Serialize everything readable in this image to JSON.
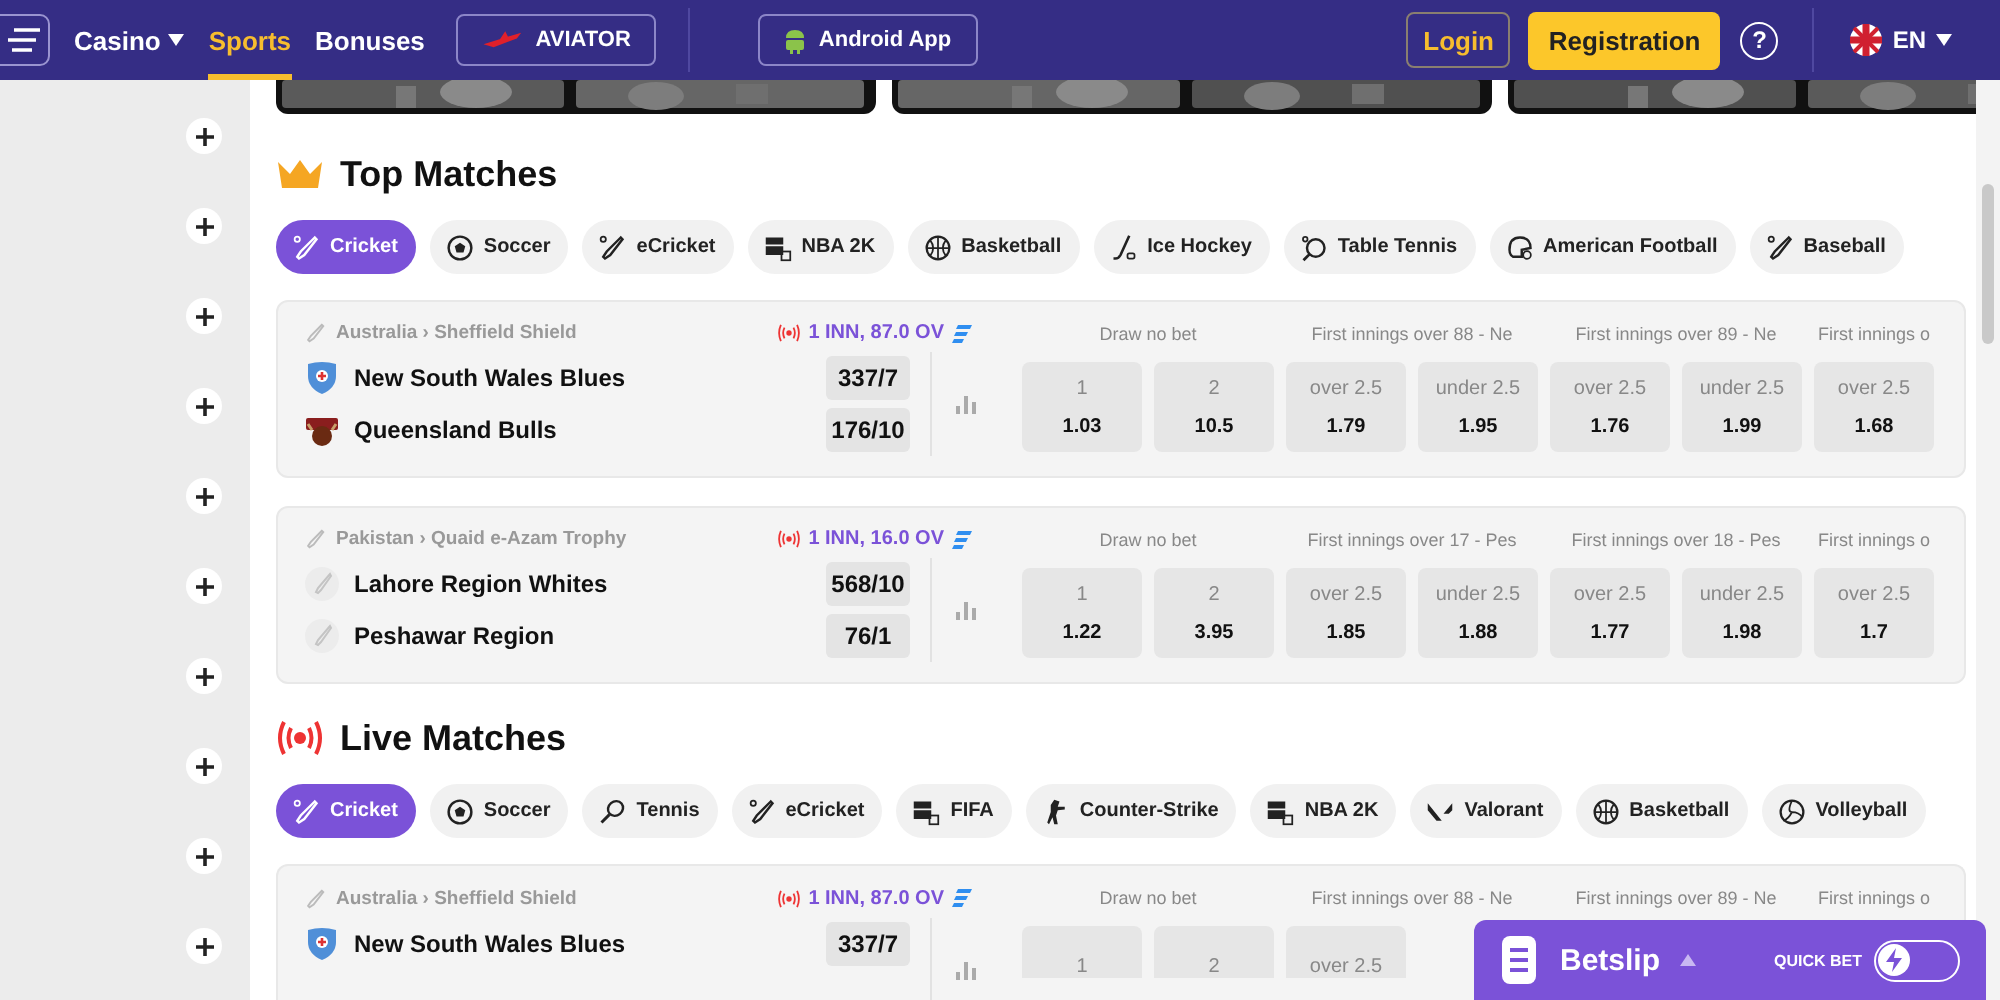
{
  "header": {
    "nav": [
      {
        "label": "Casino",
        "dropdown": true,
        "selected": false
      },
      {
        "label": "Sports",
        "dropdown": false,
        "selected": true
      },
      {
        "label": "Bonuses",
        "dropdown": false,
        "selected": false
      }
    ],
    "promo_buttons": [
      {
        "kind": "aviator",
        "label": "AVIATOR"
      },
      {
        "kind": "android",
        "label": "Android App"
      }
    ],
    "login": "Login",
    "registration": "Registration",
    "help": "?",
    "language": "EN"
  },
  "sections": [
    {
      "kind": "top",
      "title": "Top Matches",
      "sports": [
        {
          "kind": "cricket",
          "label": "Cricket",
          "selected": true
        },
        {
          "kind": "soccer",
          "label": "Soccer",
          "selected": false
        },
        {
          "kind": "ecricket",
          "label": "eCricket",
          "selected": false
        },
        {
          "kind": "nba2k",
          "label": "NBA 2K",
          "selected": false
        },
        {
          "kind": "basketball",
          "label": "Basketball",
          "selected": false
        },
        {
          "kind": "icehockey",
          "label": "Ice Hockey",
          "selected": false
        },
        {
          "kind": "tabletennis",
          "label": "Table Tennis",
          "selected": false
        },
        {
          "kind": "americanfootball",
          "label": "American Football",
          "selected": false
        },
        {
          "kind": "baseball",
          "label": "Baseball",
          "selected": false
        }
      ],
      "matches": [
        {
          "league": "Australia › Sheffield Shield",
          "status": "1 INN, 87.0 OV",
          "teams": [
            {
              "kind": "shield",
              "name": "New South Wales Blues",
              "score": "337/7"
            },
            {
              "kind": "bull",
              "name": "Queensland Bulls",
              "score": "176/10"
            }
          ],
          "markets": [
            {
              "title": "Draw no bet",
              "odds": [
                {
                  "label": "1",
                  "value": "1.03"
                },
                {
                  "label": "2",
                  "value": "10.5"
                }
              ]
            },
            {
              "title": "First innings over 88 - Ne",
              "odds": [
                {
                  "label": "over 2.5",
                  "value": "1.79"
                },
                {
                  "label": "under 2.5",
                  "value": "1.95"
                }
              ]
            },
            {
              "title": "First innings over 89 - Ne",
              "odds": [
                {
                  "label": "over 2.5",
                  "value": "1.76"
                },
                {
                  "label": "under 2.5",
                  "value": "1.99"
                }
              ]
            },
            {
              "title": "First innings o",
              "odds": [
                {
                  "label": "over 2.5",
                  "value": "1.68"
                }
              ]
            }
          ]
        },
        {
          "league": "Pakistan › Quaid e-Azam Trophy",
          "status": "1 INN, 16.0 OV",
          "teams": [
            {
              "kind": "placeholder",
              "name": "Lahore Region Whites",
              "score": "568/10"
            },
            {
              "kind": "placeholder",
              "name": "Peshawar Region",
              "score": "76/1"
            }
          ],
          "markets": [
            {
              "title": "Draw no bet",
              "odds": [
                {
                  "label": "1",
                  "value": "1.22"
                },
                {
                  "label": "2",
                  "value": "3.95"
                }
              ]
            },
            {
              "title": "First innings over 17 - Pes",
              "odds": [
                {
                  "label": "over 2.5",
                  "value": "1.85"
                },
                {
                  "label": "under 2.5",
                  "value": "1.88"
                }
              ]
            },
            {
              "title": "First innings over 18 - Pes",
              "odds": [
                {
                  "label": "over 2.5",
                  "value": "1.77"
                },
                {
                  "label": "under 2.5",
                  "value": "1.98"
                }
              ]
            },
            {
              "title": "First innings o",
              "odds": [
                {
                  "label": "over 2.5",
                  "value": "1.7"
                }
              ]
            }
          ]
        }
      ]
    },
    {
      "kind": "live",
      "title": "Live Matches",
      "sports": [
        {
          "kind": "cricket",
          "label": "Cricket",
          "selected": true
        },
        {
          "kind": "soccer",
          "label": "Soccer",
          "selected": false
        },
        {
          "kind": "tennis",
          "label": "Tennis",
          "selected": false
        },
        {
          "kind": "ecricket",
          "label": "eCricket",
          "selected": false
        },
        {
          "kind": "fifa",
          "label": "FIFA",
          "selected": false
        },
        {
          "kind": "counterstrike",
          "label": "Counter-Strike",
          "selected": false
        },
        {
          "kind": "nba2k",
          "label": "NBA 2K",
          "selected": false
        },
        {
          "kind": "valorant",
          "label": "Valorant",
          "selected": false
        },
        {
          "kind": "basketball",
          "label": "Basketball",
          "selected": false
        },
        {
          "kind": "volleyball",
          "label": "Volleyball",
          "selected": false
        }
      ],
      "matches": [
        {
          "league": "Australia › Sheffield Shield",
          "status": "1 INN, 87.0 OV",
          "teams": [
            {
              "kind": "shield",
              "name": "New South Wales Blues",
              "score": "337/7"
            }
          ],
          "markets": [
            {
              "title": "Draw no bet",
              "odds": [
                {
                  "label": "1"
                },
                {
                  "label": "2"
                }
              ]
            },
            {
              "title": "First innings over 88 - Ne",
              "odds": [
                {
                  "label": "over 2.5"
                }
              ]
            },
            {
              "title": "First innings over 89 - Ne"
            },
            {
              "title": "First innings o"
            }
          ]
        }
      ]
    }
  ],
  "betslip": {
    "title": "Betslip",
    "quick_bet": {
      "label": "QUICK BET",
      "on": false
    }
  }
}
